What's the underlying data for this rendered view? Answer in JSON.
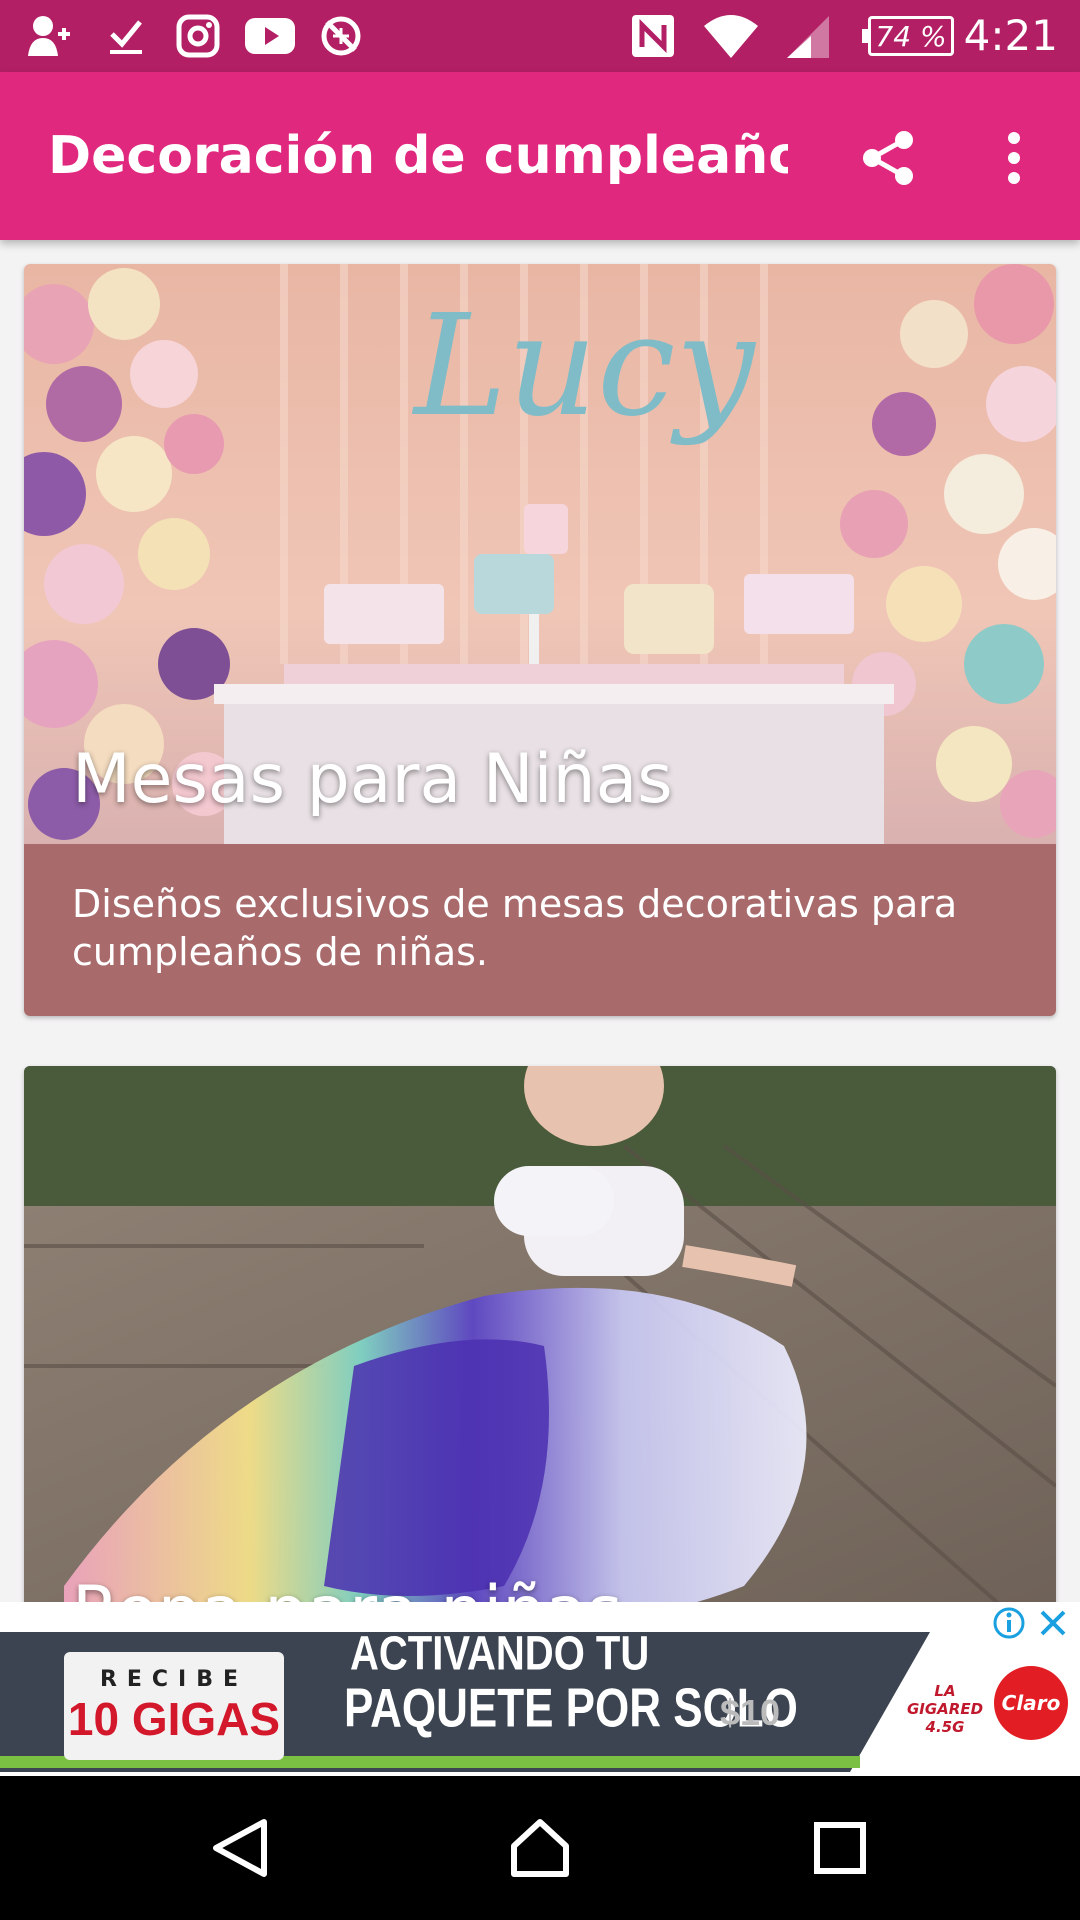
{
  "status_bar": {
    "time": "4:21",
    "battery_percent": "74 %",
    "icons": [
      "add-contact-icon",
      "check-icon",
      "instagram-icon",
      "youtube-icon",
      "no-sync-icon",
      "nfc-icon",
      "wifi-icon",
      "signal-icon",
      "battery-icon"
    ]
  },
  "app_bar": {
    "title": "Decoración de cumpleaño…",
    "share_icon": "share-icon",
    "menu_icon": "more-vert-icon"
  },
  "cards": [
    {
      "title": "Mesas para Niñas",
      "description": "Diseños exclusivos de mesas decorativas para cumpleaños de niñas.",
      "image_text": "Lucy"
    },
    {
      "title": "Ropa para niñas"
    }
  ],
  "ad": {
    "recibe": "RECIBE",
    "gigas": "10 GIGAS",
    "line1": "ACTIVANDO TU",
    "line2": "PAQUETE POR SOLO",
    "price": "$10",
    "brand_small": "LA GIGARED 4.5G",
    "brand": "Claro"
  },
  "nav": {
    "back": "back-icon",
    "home": "home-icon",
    "recents": "recents-icon"
  },
  "colors": {
    "status_bar": "#b31f64",
    "app_bar": "#e0297e",
    "card_desc_bg": "#a86a6b"
  }
}
